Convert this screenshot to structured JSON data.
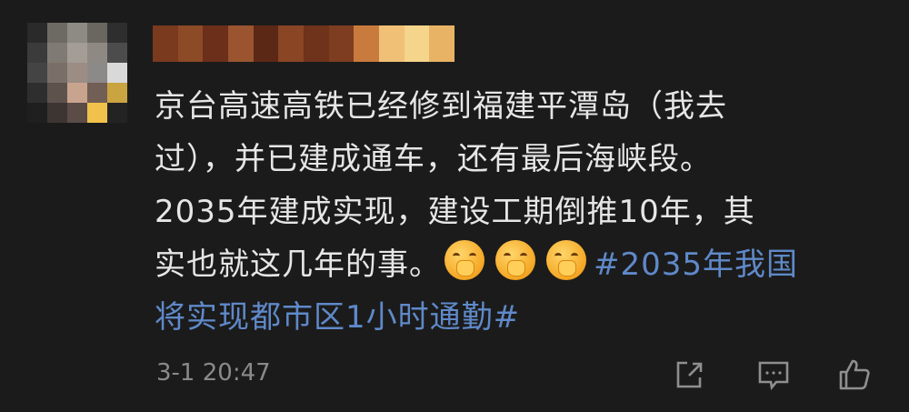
{
  "comment": {
    "lines": [
      "京台高速高铁已经修到福建平潭岛（我去",
      "过），并已建成通车，还有最后海峡段。",
      "2035年建成实现，建设工期倒推10年，其",
      "实也就这几年的事。",
      "将实现都市区1小时通勤#"
    ],
    "hashtag_start": "#2035年我国",
    "timestamp": "3-1 20:47"
  },
  "icons": {
    "share": "share-icon",
    "reply": "comment-icon",
    "like": "thumbs-up-icon",
    "emoji": "shushing-face-emoji"
  },
  "colors": {
    "background": "#1b1b1b",
    "text": "#e6e6e6",
    "hashtag": "#5f89c9",
    "meta": "#8a8a8a"
  }
}
